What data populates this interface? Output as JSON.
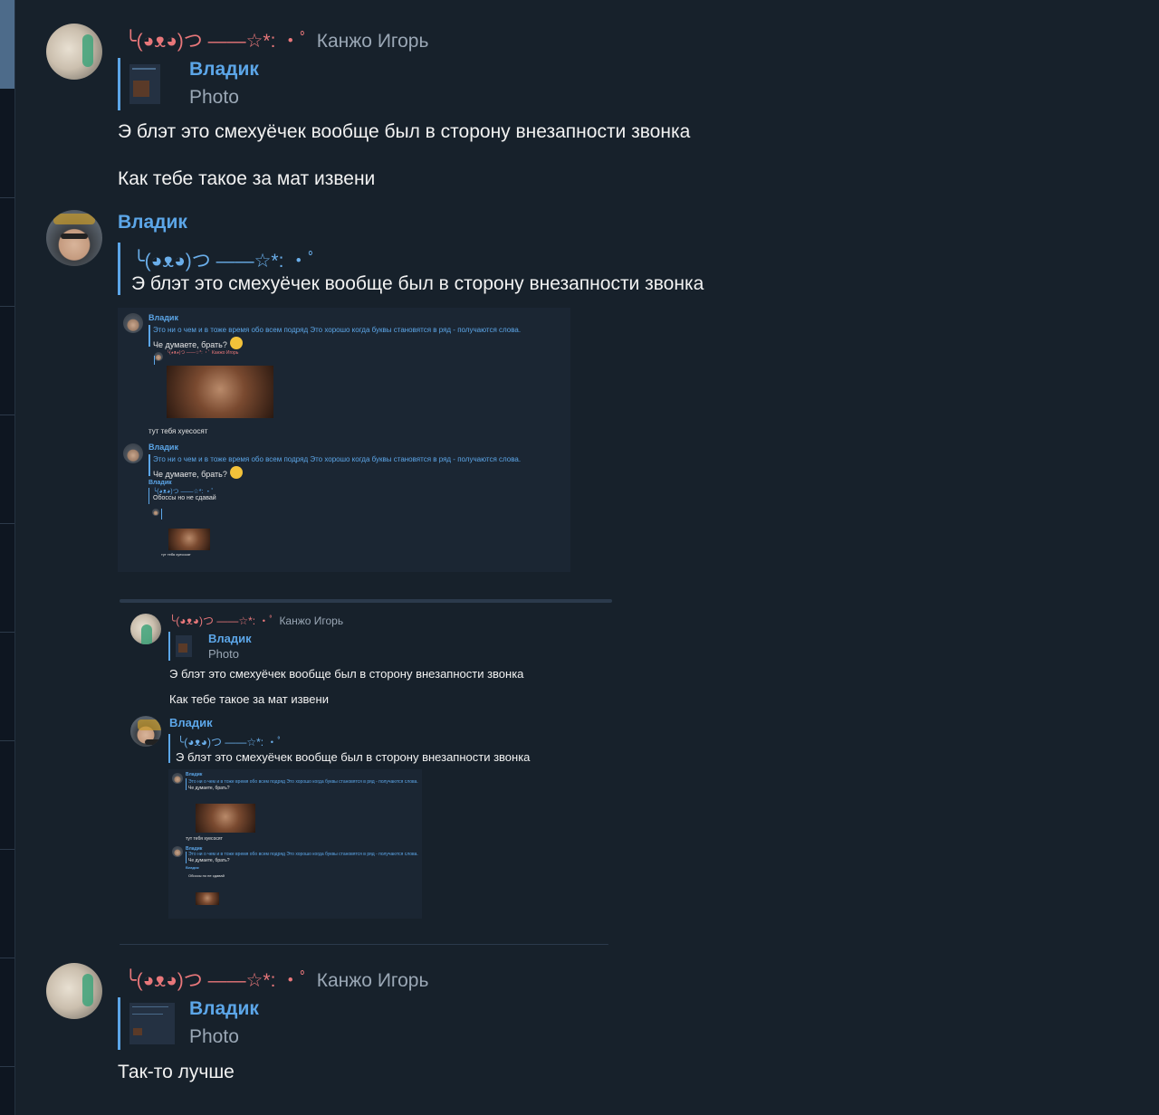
{
  "messages": [
    {
      "sender_kaomoji": "╰(◕ᴥ◕)つ ——☆*: ・ﾟ",
      "sender_name": "Канжо Игорь",
      "reply_to": {
        "name": "Владик",
        "subtitle": "Photo"
      },
      "lines": [
        "Э блэт это смехуёчек вообще был в сторону внезапности звонка",
        "Как тебе такое за мат извени"
      ]
    },
    {
      "sender_name": "Владик",
      "reply_to": {
        "kaomoji": "╰(◕ᴥ◕)つ ——☆*: ・ﾟ",
        "text": "Э блэт это смехуёчек вообще был в сторону внезапности звонка"
      },
      "screenshot": {
        "name": "Владик",
        "quote": "Это ни о чем и в тоже время обо всем подряд Это хорошо когда буквы становятся в ряд - получаются слова.",
        "question": "Че думаете, брать?",
        "inner_sender": "╰(◕ᴥ◕)つ ——☆*: ・ﾟ  Канжо Игорь",
        "caption1": "тут тебя хуесосят",
        "name2": "Владик",
        "quote2": "Это ни о чем и в тоже время обо всем подряд Это хорошо когда буквы становятся в ряд - получаются слова.",
        "question2": "Че думаете, брать?",
        "reply2_name": "Владик",
        "reply2_kaomoji": "╰(◕ᴥ◕)つ ——☆*: ・ﾟ",
        "reply2_text": "Обоссы но не сдавай",
        "caption2": "тут тебя хуесосят"
      }
    },
    {
      "forward_preview": {
        "sender_kaomoji": "╰(◕ᴥ◕)つ ——☆*: ・ﾟ",
        "sender_name": "Канжо Игорь",
        "reply_name": "Владик",
        "reply_sub": "Photo",
        "line1": "Э блэт это смехуёчек вообще был в сторону внезапности звонка",
        "line2": "Как тебе такое за мат извени",
        "name2": "Владик",
        "reply2_kaomoji": "╰(◕ᴥ◕)つ ——☆*: ・ﾟ",
        "reply2_text": "Э блэт это смехуёчек вообще был в сторону внезапности звонка",
        "mini_name": "Владик",
        "mini_quote": "Это ни о чем и в тоже время обо всем подряд Это хорошо когда буквы становятся в ряд - получаются слова.",
        "mini_question": "Че думаете, брать?",
        "mini_caption": "тут тебя хуесосят",
        "mini_name2": "Владик",
        "mini_quote2": "Это ни о чем и в тоже время обо всем подряд Это хорошо когда буквы становятся в ряд - получаются слова.",
        "mini_question2": "Че думаете, брать?",
        "mini_reply_name": "Владик",
        "mini_reply_text": "Обоссы но не сдавай"
      }
    },
    {
      "sender_kaomoji": "╰(◕ᴥ◕)つ ——☆*: ・ﾟ",
      "sender_name": "Канжо Игорь",
      "reply_to": {
        "name": "Владик",
        "subtitle": "Photo"
      },
      "lines": [
        "Так-то лучше"
      ]
    }
  ]
}
